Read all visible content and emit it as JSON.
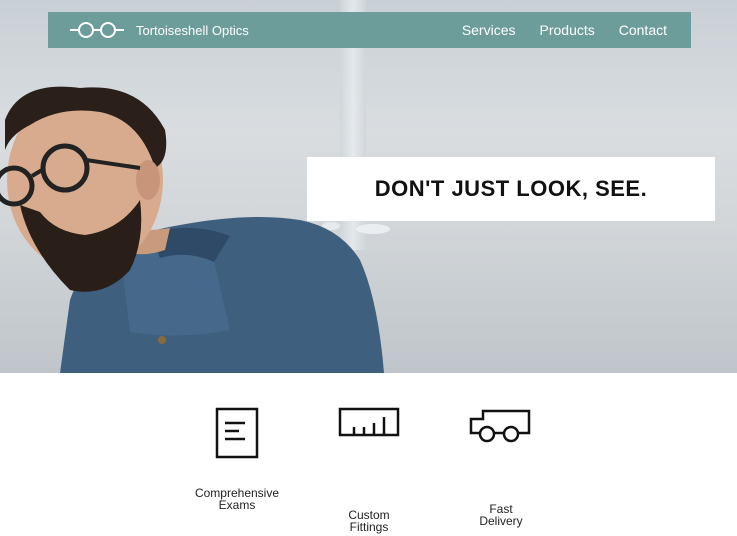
{
  "brand": {
    "name": "Tortoiseshell Optics",
    "logo_icon": "glasses-icon"
  },
  "nav": {
    "items": [
      {
        "label": "Services"
      },
      {
        "label": "Products"
      },
      {
        "label": "Contact"
      }
    ]
  },
  "hero": {
    "tagline": "DON'T JUST LOOK, SEE."
  },
  "features": [
    {
      "icon": "document-icon",
      "label": "Comprehensive\nExams"
    },
    {
      "icon": "ruler-icon",
      "label": "Custom\nFittings"
    },
    {
      "icon": "truck-icon",
      "label": "Fast\nDelivery"
    }
  ],
  "colors": {
    "navbar": "#6d9d9b",
    "text": "#222222",
    "hero_box": "#ffffff"
  }
}
